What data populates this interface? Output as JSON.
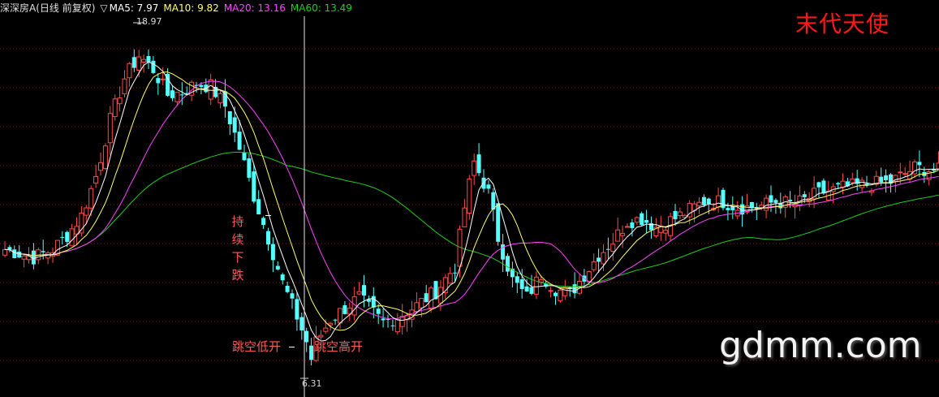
{
  "header": {
    "title": "深深房A(日线 前复权)",
    "arrow": "▽",
    "ma5_label": "MA5: 7.97",
    "ma10_label": "MA10: 9.82",
    "ma20_label": "MA20: 13.16",
    "ma60_label": "MA60: 13.49"
  },
  "colors": {
    "background": "#000000",
    "up": "#ff4a4a",
    "down": "#54ffff",
    "ma5": "#ffffff",
    "ma10": "#ffff66",
    "ma20": "#ff44ff",
    "ma60": "#22cc22",
    "grid": "#8b1a1a"
  },
  "signature": "末代天使",
  "watermark": "gdmm.com",
  "annotations": {
    "falling": "持续下跌",
    "gap_down": "跳空低开",
    "gap_up": "跳空高开"
  },
  "marks": {
    "high_label": "18.97",
    "low_label": "6.31"
  },
  "chart_data": {
    "type": "candlestick",
    "title": "深深房A(日线 前复权)",
    "price_range": [
      6.31,
      18.97
    ],
    "high": 18.97,
    "low": 6.31,
    "last_ma": {
      "MA5": 7.97,
      "MA10": 9.82,
      "MA20": 13.16,
      "MA60": 13.49
    },
    "series": [
      {
        "name": "MA5",
        "color": "#ffffff"
      },
      {
        "name": "MA10",
        "color": "#ffff66"
      },
      {
        "name": "MA20",
        "color": "#ff44ff"
      },
      {
        "name": "MA60",
        "color": "#22cc22"
      }
    ],
    "close_path": [
      [
        0,
        10.9
      ],
      [
        6,
        10.6
      ],
      [
        10,
        10.9
      ],
      [
        13,
        11.4
      ],
      [
        16,
        12.1
      ],
      [
        19,
        13.5
      ],
      [
        22,
        15.5
      ],
      [
        25,
        17.0
      ],
      [
        28,
        17.8
      ],
      [
        31,
        17.3
      ],
      [
        34,
        16.4
      ],
      [
        37,
        16.5
      ],
      [
        40,
        16.8
      ],
      [
        43,
        16.7
      ],
      [
        46,
        16.0
      ],
      [
        49,
        14.5
      ],
      [
        52,
        12.8
      ],
      [
        55,
        11.3
      ],
      [
        58,
        9.7
      ],
      [
        61,
        8.5
      ],
      [
        63,
        7.6
      ],
      [
        64,
        7.0
      ],
      [
        65,
        7.6
      ],
      [
        68,
        8.4
      ],
      [
        71,
        8.8
      ],
      [
        74,
        9.2
      ],
      [
        76,
        8.8
      ],
      [
        79,
        8.3
      ],
      [
        82,
        8.5
      ],
      [
        86,
        8.9
      ],
      [
        90,
        9.4
      ],
      [
        94,
        10.3
      ],
      [
        96,
        12.4
      ],
      [
        98,
        14.0
      ],
      [
        101,
        12.9
      ],
      [
        103,
        11.3
      ],
      [
        106,
        9.8
      ],
      [
        109,
        9.2
      ],
      [
        112,
        10.0
      ],
      [
        115,
        9.5
      ],
      [
        118,
        9.3
      ],
      [
        121,
        10.0
      ],
      [
        124,
        10.7
      ],
      [
        127,
        11.2
      ],
      [
        130,
        11.9
      ],
      [
        133,
        12.0
      ],
      [
        136,
        11.7
      ],
      [
        140,
        12.0
      ],
      [
        143,
        12.3
      ],
      [
        146,
        12.6
      ],
      [
        150,
        12.6
      ],
      [
        153,
        12.4
      ],
      [
        157,
        12.4
      ],
      [
        161,
        12.6
      ],
      [
        165,
        12.5
      ],
      [
        170,
        12.9
      ],
      [
        175,
        13.1
      ],
      [
        180,
        13.2
      ],
      [
        185,
        13.3
      ],
      [
        190,
        13.8
      ],
      [
        195,
        13.7
      ]
    ],
    "notes": [
      "持续下跌",
      "跳空低开",
      "跳空高开"
    ]
  }
}
